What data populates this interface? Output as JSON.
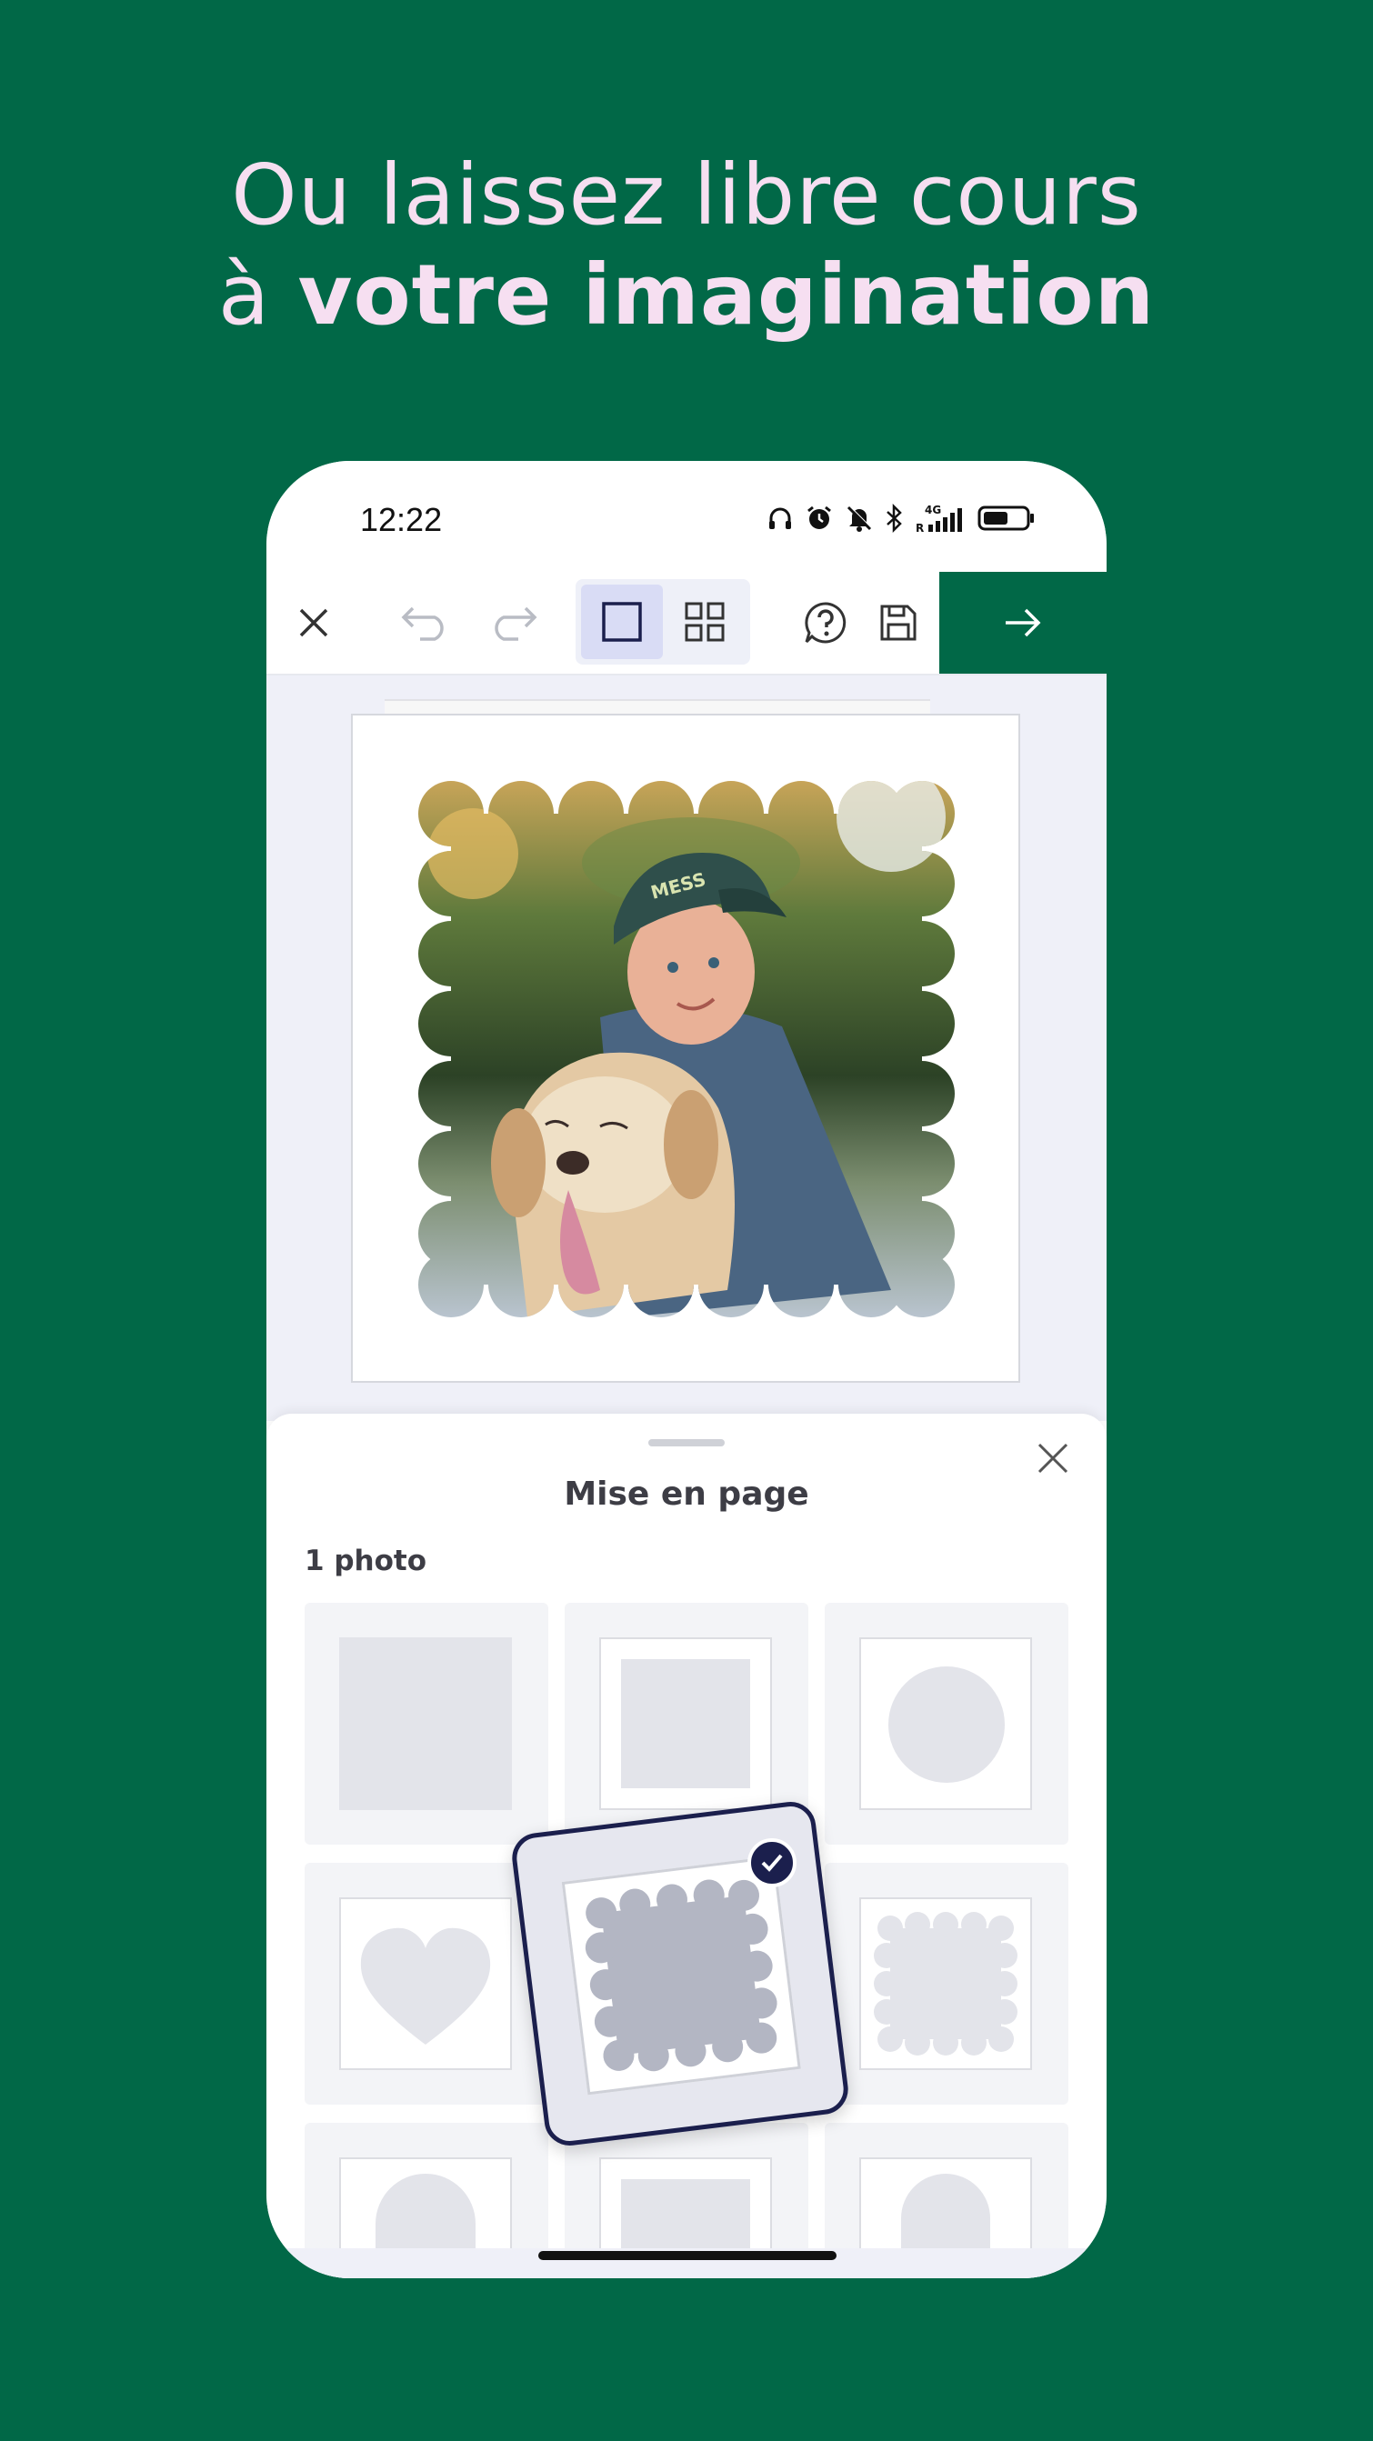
{
  "headline": {
    "line1": "Ou laissez libre cours",
    "line2_prefix": "à ",
    "line2_bold": "votre imagination"
  },
  "status_bar": {
    "time": "12:22",
    "icons": [
      "headphones-icon",
      "alarm-icon",
      "mute-icon",
      "bluetooth-icon",
      "signal-4g-icon",
      "battery-icon"
    ]
  },
  "toolbar": {
    "icons": [
      "close-icon",
      "undo-icon",
      "redo-icon",
      "single-view-icon",
      "grid-view-icon",
      "help-icon",
      "save-icon",
      "arrow-right-icon"
    ]
  },
  "sheet": {
    "title": "Mise en page",
    "section_label": "1 photo",
    "layouts": [
      "square-full",
      "square-framed",
      "circle",
      "heart",
      "scalloped-selected",
      "scalloped",
      "arch",
      "rectangle",
      "arch-2"
    ]
  },
  "colors": {
    "brand_green": "#016847",
    "headline_pink": "#f6dff1",
    "selection_navy": "#1b1f4d",
    "canvas_bg": "#eff0f8"
  }
}
